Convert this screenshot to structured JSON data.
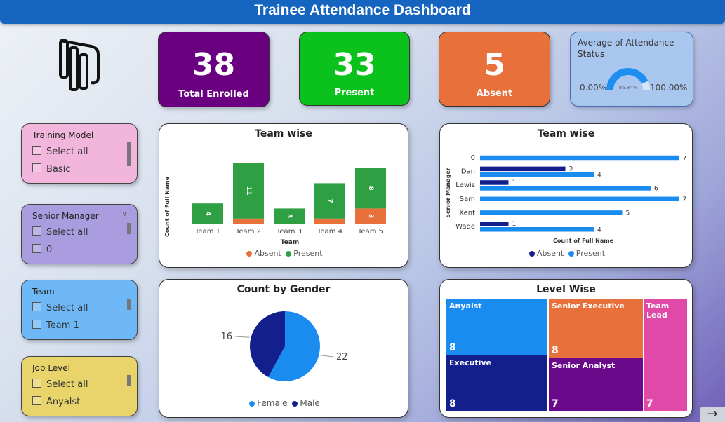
{
  "header": {
    "title": "Trainee Attendance Dashboard"
  },
  "kpis": [
    {
      "value": "38",
      "label": "Total Enrolled",
      "color": "#6a0080"
    },
    {
      "value": "33",
      "label": "Present",
      "color": "#0bc21d"
    },
    {
      "value": "5",
      "label": "Absent",
      "color": "#e8703a"
    }
  ],
  "gauge": {
    "title": "Average of Attendance Status",
    "min_label": "0.00%",
    "max_label": "100.00%",
    "value_label": "86.84%",
    "value": 0.8684,
    "color": "#1f8ef1"
  },
  "slicers": [
    {
      "title": "Training Model",
      "items": [
        "Select all",
        "Basic"
      ],
      "color": "#f2b5dc"
    },
    {
      "title": "Senior Manager",
      "items": [
        "Select all",
        "0"
      ],
      "color": "#a99ddf"
    },
    {
      "title": "Team",
      "items": [
        "Select all",
        "Team 1"
      ],
      "color": "#6fb8f7"
    },
    {
      "title": "Job Level",
      "items": [
        "Select all",
        "Anyalst"
      ],
      "color": "#e9d46b"
    }
  ],
  "team_column": {
    "title": "Team wise",
    "xlabel": "Team",
    "ylabel": "Count of Full Name",
    "legend": [
      "Absent",
      "Present"
    ]
  },
  "team_bar": {
    "title": "Team wise",
    "xlabel": "Count of Full Name",
    "ylabel": "Senior Manager",
    "legend": [
      "Absent",
      "Present"
    ]
  },
  "gender": {
    "title": "Count by Gender",
    "legend": [
      "Female",
      "Male"
    ]
  },
  "level": {
    "title": "Level Wise",
    "items": [
      {
        "label": "Anyalst",
        "value": 8,
        "color": "#1a8cf0"
      },
      {
        "label": "Senior Executive",
        "value": 8,
        "color": "#e8703a"
      },
      {
        "label": "Team Lead",
        "value": 7,
        "color": "#e049a8"
      },
      {
        "label": "Executive",
        "value": 8,
        "color": "#131f8c"
      },
      {
        "label": "Senior Analyst",
        "value": 7,
        "color": "#6a0a8a"
      }
    ]
  },
  "nav": {
    "next_label": "→"
  },
  "chart_data": [
    {
      "type": "bar",
      "title": "Team wise",
      "xlabel": "Team",
      "ylabel": "Count of Full Name",
      "categories": [
        "Team 1",
        "Team 2",
        "Team 3",
        "Team 4",
        "Team 5"
      ],
      "series": [
        {
          "name": "Present",
          "values": [
            4,
            11,
            3,
            7,
            8
          ],
          "color": "#2ea043"
        },
        {
          "name": "Absent",
          "values": [
            0,
            1,
            0,
            1,
            3
          ],
          "color": "#e8703a"
        }
      ],
      "data_labels": {
        "Present": [
          "4",
          "11",
          "3",
          "7",
          "8"
        ],
        "Absent": [
          "",
          "",
          "",
          "",
          "3"
        ]
      },
      "stacked": true,
      "legend": "bottom"
    },
    {
      "type": "bar",
      "orientation": "horizontal",
      "title": "Team wise",
      "xlabel": "Count of Full Name",
      "ylabel": "Senior Manager",
      "categories": [
        "0",
        "Dan",
        "Lewis",
        "Sam",
        "Kent",
        "Wade"
      ],
      "series": [
        {
          "name": "Absent",
          "values": [
            null,
            3,
            1,
            null,
            null,
            1
          ],
          "color": "#131f8c"
        },
        {
          "name": "Present",
          "values": [
            7,
            4,
            6,
            7,
            5,
            4
          ],
          "color": "#1a8cf0"
        }
      ],
      "legend": "bottom"
    },
    {
      "type": "pie",
      "title": "Count by Gender",
      "categories": [
        "Female",
        "Male"
      ],
      "values": [
        22,
        16
      ],
      "colors": [
        "#1a8cf0",
        "#131f8c"
      ],
      "legend": "bottom"
    }
  ]
}
